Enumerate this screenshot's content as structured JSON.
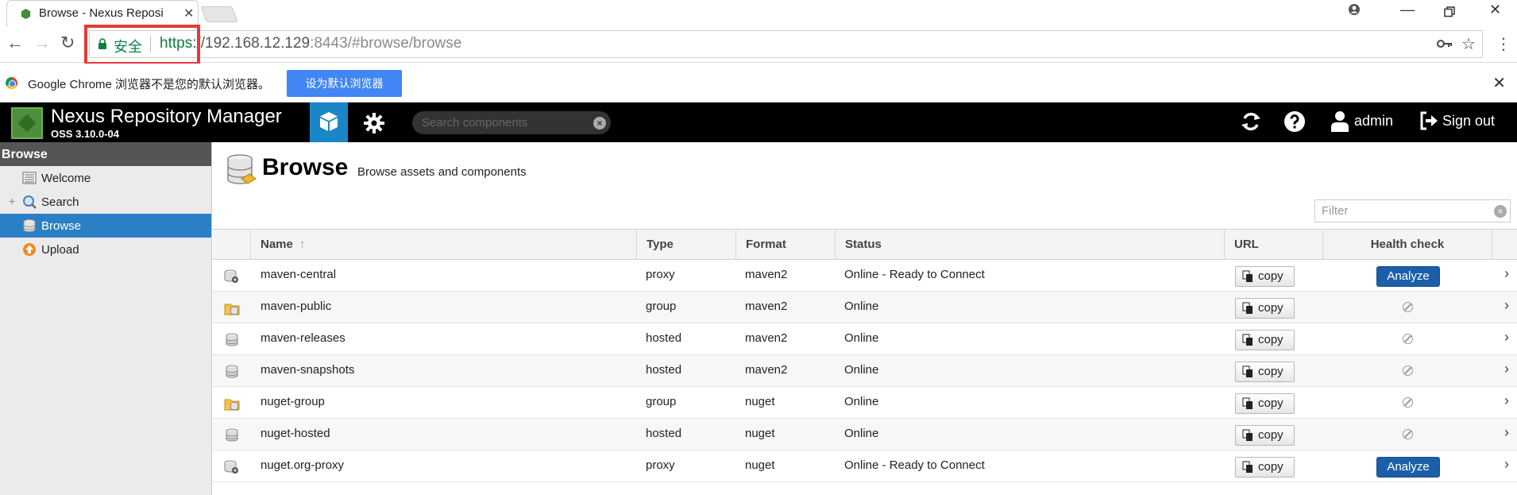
{
  "browser": {
    "tab_title": "Browse - Nexus Reposi",
    "tab_close": "✕",
    "secure_label": "安全",
    "url_scheme": "https",
    "url_host": "://192.168.12.129",
    "url_port": ":8443",
    "url_path": "/#browse/browse"
  },
  "infobar": {
    "message": "Google Chrome 浏览器不是您的默认浏览器。",
    "button": "设为默认浏览器",
    "close": "✕"
  },
  "header": {
    "app_title": "Nexus Repository Manager",
    "version": "OSS 3.10.0-04",
    "search_placeholder": "Search components",
    "user": "admin",
    "signout": "Sign out"
  },
  "sidebar": {
    "heading": "Browse",
    "items": [
      {
        "label": "Welcome",
        "icon": "welcome-icon",
        "active": false
      },
      {
        "label": "Search",
        "icon": "search-icon",
        "active": false
      },
      {
        "label": "Browse",
        "icon": "database-icon",
        "active": true
      },
      {
        "label": "Upload",
        "icon": "upload-icon",
        "active": false
      }
    ]
  },
  "page": {
    "title": "Browse",
    "subtitle": "Browse assets and components",
    "filter_placeholder": "Filter"
  },
  "table": {
    "columns": {
      "name": "Name",
      "type": "Type",
      "format": "Format",
      "status": "Status",
      "url": "URL",
      "health": "Health check"
    },
    "copy_label": "copy",
    "analyze_label": "Analyze",
    "rows": [
      {
        "name": "maven-central",
        "type": "proxy",
        "format": "maven2",
        "status": "Online - Ready to Connect",
        "health": "analyze"
      },
      {
        "name": "maven-public",
        "type": "group",
        "format": "maven2",
        "status": "Online",
        "health": "na"
      },
      {
        "name": "maven-releases",
        "type": "hosted",
        "format": "maven2",
        "status": "Online",
        "health": "na"
      },
      {
        "name": "maven-snapshots",
        "type": "hosted",
        "format": "maven2",
        "status": "Online",
        "health": "na"
      },
      {
        "name": "nuget-group",
        "type": "group",
        "format": "nuget",
        "status": "Online",
        "health": "na"
      },
      {
        "name": "nuget-hosted",
        "type": "hosted",
        "format": "nuget",
        "status": "Online",
        "health": "na"
      },
      {
        "name": "nuget.org-proxy",
        "type": "proxy",
        "format": "nuget",
        "status": "Online - Ready to Connect",
        "health": "analyze"
      }
    ]
  },
  "colors": {
    "accent": "#2b7fc5",
    "analyze": "#1c5fa8",
    "highlight_box": "#e53a3a",
    "secure_green": "#0b8043"
  }
}
